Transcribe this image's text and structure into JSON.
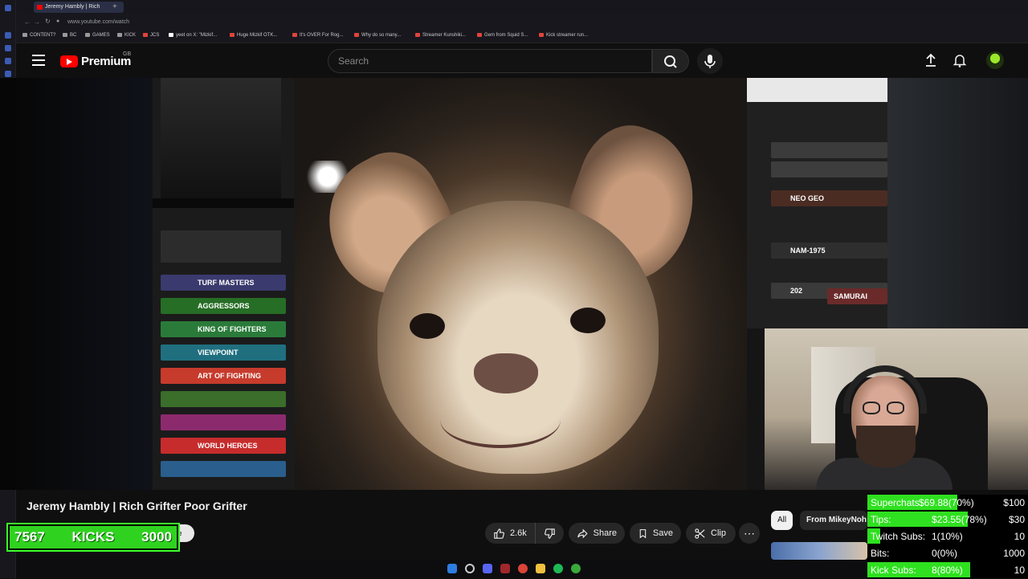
{
  "browser": {
    "tab_title": "Jeremy Hambly | Rich",
    "url": "www.youtube.com/watch",
    "bookmarks": [
      "CONTENT?",
      "BC",
      "GAMES",
      "KICK",
      "JCS",
      "yeet on X: \"Mizkif...",
      "Huge Mizkif OTK...",
      "It's OVER For Rog...",
      "Why do so many...",
      "Streamer Kunshiki...",
      "Gem from Squid S...",
      "Kick streamer run..."
    ]
  },
  "youtube": {
    "brand": "Premium",
    "region": "GB",
    "search_placeholder": "Search"
  },
  "video": {
    "title": "Jeremy Hambly | Rich Grifter Poor Grifter",
    "like_count": "2.6k",
    "share_label": "Share",
    "save_label": "Save",
    "clip_label": "Clip",
    "subscribe_partial": "e"
  },
  "shelf_left": [
    "TURF MASTERS",
    "AGGRESSORS",
    "KING OF FIGHTERS",
    "VIEWPOINT",
    "ART OF FIGHTING",
    "WORLD HEROES"
  ],
  "shelf_right": [
    "NEO GEO",
    "NAM-1975",
    "202",
    "SAMURAI"
  ],
  "recommendations": {
    "chips": [
      "All",
      "From MikeyNoh"
    ]
  },
  "kicks_widget": {
    "current": "7567",
    "label": "KICKS",
    "goal": "3000"
  },
  "donation_overlay": {
    "rows": [
      {
        "label": "Superchats",
        "value": "$69.88(70%)",
        "goal": "$100",
        "fill": 0.7
      },
      {
        "label": "Tips:",
        "value": "$23.55(78%)",
        "goal": "$30",
        "fill": 0.78
      },
      {
        "label": "Twitch Subs:",
        "value": "1(10%)",
        "goal": "10",
        "fill": 0.1
      },
      {
        "label": "Bits:",
        "value": "0(0%)",
        "goal": "1000",
        "fill": 0.0
      },
      {
        "label": "Kick Subs:",
        "value": "8(80%)",
        "goal": "10",
        "fill": 0.8
      }
    ],
    "bar_color": "#2ee01f"
  },
  "colors": {
    "accent_red": "#ff0000",
    "kick_green": "#2fd31f",
    "background": "#0f0f0f"
  }
}
